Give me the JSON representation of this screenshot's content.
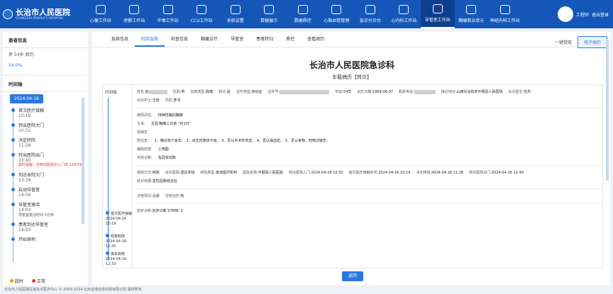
{
  "brand": {
    "name": "长治市人民医院",
    "sub": "CHANGZHI PEOPLE'S HOSPITAL"
  },
  "nav": [
    {
      "label": "心梗工作站"
    },
    {
      "label": "房颤工作站"
    },
    {
      "label": "中毒工作站"
    },
    {
      "label": "CCU工作站"
    },
    {
      "label": "系统设置"
    },
    {
      "label": "数据展示"
    },
    {
      "label": "数据质控"
    },
    {
      "label": "心脑血管管理"
    },
    {
      "label": "急诊分诊台"
    },
    {
      "label": "心内科工作站"
    },
    {
      "label": "导管室工作站"
    },
    {
      "label": "胸痛救治单元"
    },
    {
      "label": "神经内科工作站"
    }
  ],
  "user": {
    "name": "工程师",
    "logout": "退出登录"
  },
  "left": {
    "patient_title": "患者信息",
    "patient_line": "男   54岁   病历:",
    "percent": "54.0%",
    "timeline_title": "时间轴",
    "date": "2024-04-16",
    "events": [
      {
        "name": "首次医疗接触",
        "time": "10:19"
      },
      {
        "name": "转出医院大门",
        "time": "10:32"
      },
      {
        "name": "决定转院",
        "time": "11:28"
      },
      {
        "name": "转出医院出门",
        "time": "12:40",
        "alert": "超时提醒：在转出医院出入门出 129分钟"
      },
      {
        "name": "到达本院大门",
        "time": "13:38"
      },
      {
        "name": "启动导管室",
        "time": "14:04"
      },
      {
        "name": "导管室激活",
        "time": "14:04",
        "note": "导管室激活时间 0分钟"
      },
      {
        "name": "患者到达导管室",
        "time": "14:05"
      },
      {
        "name": "开始穿刺",
        "time": ""
      }
    ],
    "legend": [
      {
        "label": "超时",
        "color": "#e8a400"
      },
      {
        "label": "正常",
        "color": "#e33b3b"
      }
    ]
  },
  "tabs": [
    {
      "label": "急救信息"
    },
    {
      "label": "院前急救",
      "active": true
    },
    {
      "label": "检查信息"
    },
    {
      "label": "胸痛诊疗"
    },
    {
      "label": "导管室"
    },
    {
      "label": "患者转归"
    },
    {
      "label": "质控"
    },
    {
      "label": "查看病历"
    }
  ],
  "tools": {
    "oneclick": "一键提取",
    "emr": "电子病历"
  },
  "doc": {
    "title": "长治市人民医院急诊科",
    "subtitle": "车载病历【转诊】",
    "tl_label": "时间轴",
    "tl_events": [
      {
        "name": "首次医疗接触",
        "date": "2024-04-16",
        "time": "10:19"
      },
      {
        "name": "经救到院",
        "date": "2024-04-16",
        "time": "12:30"
      },
      {
        "name": "离车到院",
        "date": "2024-04-16",
        "time": "12:33"
      }
    ],
    "row1": [
      {
        "l": "姓名:",
        "v": "赵"
      },
      {
        "l": "性别:",
        "v": "男"
      },
      {
        "l": "急救类型:",
        "v": "院端"
      },
      {
        "l": "转诊:",
        "v": "是"
      },
      {
        "l": "证件类型:",
        "v": "身份证"
      },
      {
        "l": "证件号:",
        "v": ""
      },
      {
        "l": "年龄:",
        "v": "54岁"
      },
      {
        "l": "出生日期:",
        "v": "1969-06-07"
      },
      {
        "l": "联系电话:",
        "v": ""
      },
      {
        "l": "接诊地址:",
        "v": "山西长治县宋平顺县人民医院"
      },
      {
        "l": "出诊医生:",
        "v": "任杰"
      }
    ],
    "row2": [
      {
        "l": "出诊护士:",
        "v": "王桂"
      },
      {
        "l": "司机:",
        "v": "李书"
      }
    ],
    "clinical": [
      {
        "l": "病情评估:",
        "v": "持续性胸闷胸痛"
      },
      {
        "l": "主诉:",
        "v": "主因 胸痛三日余 “约1日”"
      },
      {
        "l": "现病史:",
        "v": ""
      },
      {
        "l": "既往史:",
        "v": "1、确诊高十余年。 2、出生时肢体不良。 3、否认手术外伤史。 4、否认输血史。 5、否认食物、药物过敏史。"
      },
      {
        "l": "辅助检查:",
        "v": "心电图"
      },
      {
        "l": "外院诊断:",
        "v": "急冠状动脉"
      }
    ],
    "transport": [
      {
        "l": "来院方式:",
        "v": "转院"
      },
      {
        "l": "出车医院:",
        "v": "送往本院"
      },
      {
        "l": "转院类型:",
        "v": "其他医疗机构"
      },
      {
        "l": "医院名称:",
        "v": "平顺县人民医院"
      },
      {
        "l": "转出医院入门:",
        "v": "2024-04-16 10:32"
      },
      {
        "l": "首次医疗接触时间:",
        "v": "2024-04-16 10:19"
      },
      {
        "l": "决定转院:",
        "v": "2024-04-16 11:28"
      },
      {
        "l": "转出医院出门:",
        "v": "2024-04-16 12:40"
      }
    ],
    "transport2": [
      {
        "l": "转诊依据:",
        "v": "急性冠脉综合征"
      }
    ],
    "status": [
      {
        "l": "溶栓情况:",
        "v": "合适"
      },
      {
        "l": "溶栓治疗:",
        "v": "有"
      }
    ],
    "diagnosis": [
      {
        "l": "初步诊断:",
        "v": "初步诊断 STEMI: 1"
      }
    ]
  },
  "back": "返回",
  "footer": "长治市人民医院区域急诊医疗中心    © 2009-2024 北京迪浩信息科技有限公司 版权所有"
}
